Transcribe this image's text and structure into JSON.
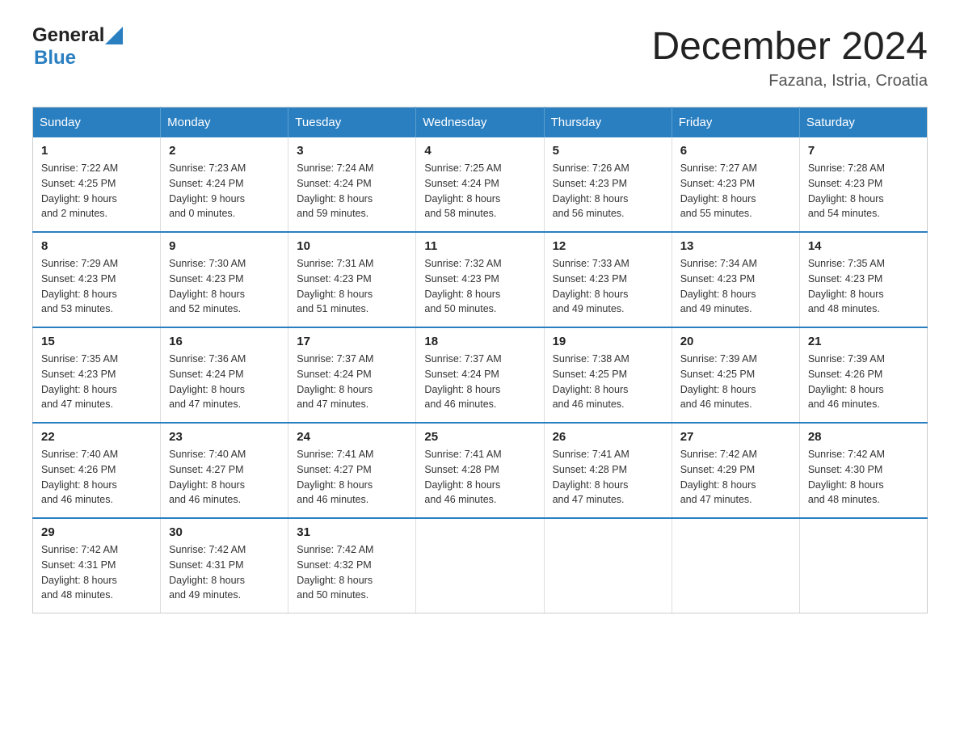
{
  "header": {
    "logo_general": "General",
    "logo_blue": "Blue",
    "title": "December 2024",
    "location": "Fazana, Istria, Croatia"
  },
  "days_of_week": [
    "Sunday",
    "Monday",
    "Tuesday",
    "Wednesday",
    "Thursday",
    "Friday",
    "Saturday"
  ],
  "weeks": [
    [
      {
        "day": "1",
        "sunrise": "7:22 AM",
        "sunset": "4:25 PM",
        "daylight": "9 hours and 2 minutes."
      },
      {
        "day": "2",
        "sunrise": "7:23 AM",
        "sunset": "4:24 PM",
        "daylight": "9 hours and 0 minutes."
      },
      {
        "day": "3",
        "sunrise": "7:24 AM",
        "sunset": "4:24 PM",
        "daylight": "8 hours and 59 minutes."
      },
      {
        "day": "4",
        "sunrise": "7:25 AM",
        "sunset": "4:24 PM",
        "daylight": "8 hours and 58 minutes."
      },
      {
        "day": "5",
        "sunrise": "7:26 AM",
        "sunset": "4:23 PM",
        "daylight": "8 hours and 56 minutes."
      },
      {
        "day": "6",
        "sunrise": "7:27 AM",
        "sunset": "4:23 PM",
        "daylight": "8 hours and 55 minutes."
      },
      {
        "day": "7",
        "sunrise": "7:28 AM",
        "sunset": "4:23 PM",
        "daylight": "8 hours and 54 minutes."
      }
    ],
    [
      {
        "day": "8",
        "sunrise": "7:29 AM",
        "sunset": "4:23 PM",
        "daylight": "8 hours and 53 minutes."
      },
      {
        "day": "9",
        "sunrise": "7:30 AM",
        "sunset": "4:23 PM",
        "daylight": "8 hours and 52 minutes."
      },
      {
        "day": "10",
        "sunrise": "7:31 AM",
        "sunset": "4:23 PM",
        "daylight": "8 hours and 51 minutes."
      },
      {
        "day": "11",
        "sunrise": "7:32 AM",
        "sunset": "4:23 PM",
        "daylight": "8 hours and 50 minutes."
      },
      {
        "day": "12",
        "sunrise": "7:33 AM",
        "sunset": "4:23 PM",
        "daylight": "8 hours and 49 minutes."
      },
      {
        "day": "13",
        "sunrise": "7:34 AM",
        "sunset": "4:23 PM",
        "daylight": "8 hours and 49 minutes."
      },
      {
        "day": "14",
        "sunrise": "7:35 AM",
        "sunset": "4:23 PM",
        "daylight": "8 hours and 48 minutes."
      }
    ],
    [
      {
        "day": "15",
        "sunrise": "7:35 AM",
        "sunset": "4:23 PM",
        "daylight": "8 hours and 47 minutes."
      },
      {
        "day": "16",
        "sunrise": "7:36 AM",
        "sunset": "4:24 PM",
        "daylight": "8 hours and 47 minutes."
      },
      {
        "day": "17",
        "sunrise": "7:37 AM",
        "sunset": "4:24 PM",
        "daylight": "8 hours and 47 minutes."
      },
      {
        "day": "18",
        "sunrise": "7:37 AM",
        "sunset": "4:24 PM",
        "daylight": "8 hours and 46 minutes."
      },
      {
        "day": "19",
        "sunrise": "7:38 AM",
        "sunset": "4:25 PM",
        "daylight": "8 hours and 46 minutes."
      },
      {
        "day": "20",
        "sunrise": "7:39 AM",
        "sunset": "4:25 PM",
        "daylight": "8 hours and 46 minutes."
      },
      {
        "day": "21",
        "sunrise": "7:39 AM",
        "sunset": "4:26 PM",
        "daylight": "8 hours and 46 minutes."
      }
    ],
    [
      {
        "day": "22",
        "sunrise": "7:40 AM",
        "sunset": "4:26 PM",
        "daylight": "8 hours and 46 minutes."
      },
      {
        "day": "23",
        "sunrise": "7:40 AM",
        "sunset": "4:27 PM",
        "daylight": "8 hours and 46 minutes."
      },
      {
        "day": "24",
        "sunrise": "7:41 AM",
        "sunset": "4:27 PM",
        "daylight": "8 hours and 46 minutes."
      },
      {
        "day": "25",
        "sunrise": "7:41 AM",
        "sunset": "4:28 PM",
        "daylight": "8 hours and 46 minutes."
      },
      {
        "day": "26",
        "sunrise": "7:41 AM",
        "sunset": "4:28 PM",
        "daylight": "8 hours and 47 minutes."
      },
      {
        "day": "27",
        "sunrise": "7:42 AM",
        "sunset": "4:29 PM",
        "daylight": "8 hours and 47 minutes."
      },
      {
        "day": "28",
        "sunrise": "7:42 AM",
        "sunset": "4:30 PM",
        "daylight": "8 hours and 48 minutes."
      }
    ],
    [
      {
        "day": "29",
        "sunrise": "7:42 AM",
        "sunset": "4:31 PM",
        "daylight": "8 hours and 48 minutes."
      },
      {
        "day": "30",
        "sunrise": "7:42 AM",
        "sunset": "4:31 PM",
        "daylight": "8 hours and 49 minutes."
      },
      {
        "day": "31",
        "sunrise": "7:42 AM",
        "sunset": "4:32 PM",
        "daylight": "8 hours and 50 minutes."
      },
      null,
      null,
      null,
      null
    ]
  ],
  "labels": {
    "sunrise": "Sunrise:",
    "sunset": "Sunset:",
    "daylight": "Daylight:"
  }
}
